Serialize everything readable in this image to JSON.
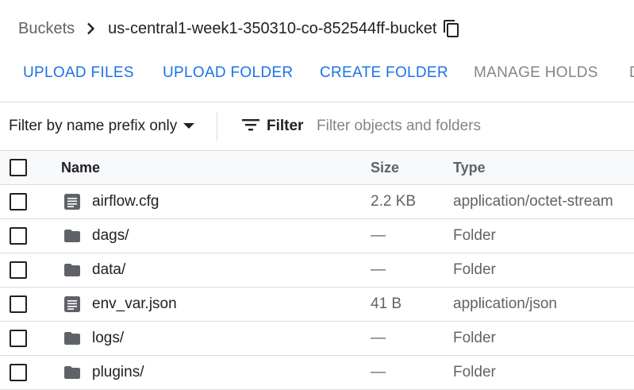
{
  "breadcrumb": {
    "root": "Buckets",
    "current": "us-central1-week1-350310-co-852544ff-bucket"
  },
  "actions": [
    {
      "label": "UPLOAD FILES",
      "enabled": true
    },
    {
      "label": "UPLOAD FOLDER",
      "enabled": true
    },
    {
      "label": "CREATE FOLDER",
      "enabled": true
    },
    {
      "label": "MANAGE HOLDS",
      "enabled": false
    },
    {
      "label": "D",
      "enabled": false
    }
  ],
  "filter": {
    "prefix_label": "Filter by name prefix only",
    "button_label": "Filter",
    "placeholder": "Filter objects and folders"
  },
  "table": {
    "columns": {
      "name": "Name",
      "size": "Size",
      "type": "Type"
    },
    "rows": [
      {
        "icon": "file-icon",
        "name": "airflow.cfg",
        "size": "2.2 KB",
        "type": "application/octet-stream"
      },
      {
        "icon": "folder-icon",
        "name": "dags/",
        "size": "—",
        "type": "Folder"
      },
      {
        "icon": "folder-icon",
        "name": "data/",
        "size": "—",
        "type": "Folder"
      },
      {
        "icon": "file-icon",
        "name": "env_var.json",
        "size": "41 B",
        "type": "application/json"
      },
      {
        "icon": "folder-icon",
        "name": "logs/",
        "size": "—",
        "type": "Folder"
      },
      {
        "icon": "folder-icon",
        "name": "plugins/",
        "size": "—",
        "type": "Folder"
      }
    ]
  },
  "colors": {
    "accent": "#1a73e8",
    "disabled": "#80868b",
    "icon": "#5f6368",
    "divider": "#dadce0"
  }
}
